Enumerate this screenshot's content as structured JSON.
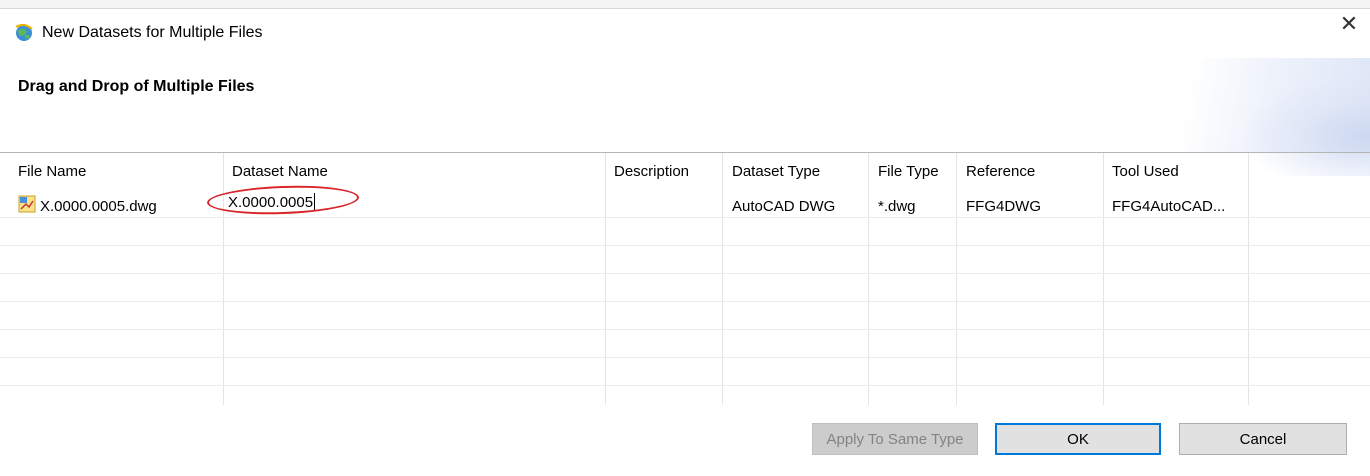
{
  "window": {
    "title": "New Datasets for Multiple Files",
    "close_symbol": "✕"
  },
  "header": {
    "heading": "Drag and Drop of Multiple Files"
  },
  "table": {
    "columns": [
      "File Name",
      "Dataset Name",
      "Description",
      "Dataset Type",
      "File Type",
      "Reference",
      "Tool Used"
    ],
    "rows": [
      {
        "file_name": "X.0000.0005.dwg",
        "dataset_name": "X.0000.0005",
        "description": "",
        "dataset_type": "AutoCAD DWG",
        "file_type": "*.dwg",
        "reference": "FFG4DWG",
        "tool_used": "FFG4AutoCAD..."
      }
    ]
  },
  "buttons": {
    "apply_same_type": "Apply To Same Type",
    "ok": "OK",
    "cancel": "Cancel"
  },
  "colors": {
    "highlight_ellipse": "#d9262a",
    "ok_border": "#0078d7"
  }
}
